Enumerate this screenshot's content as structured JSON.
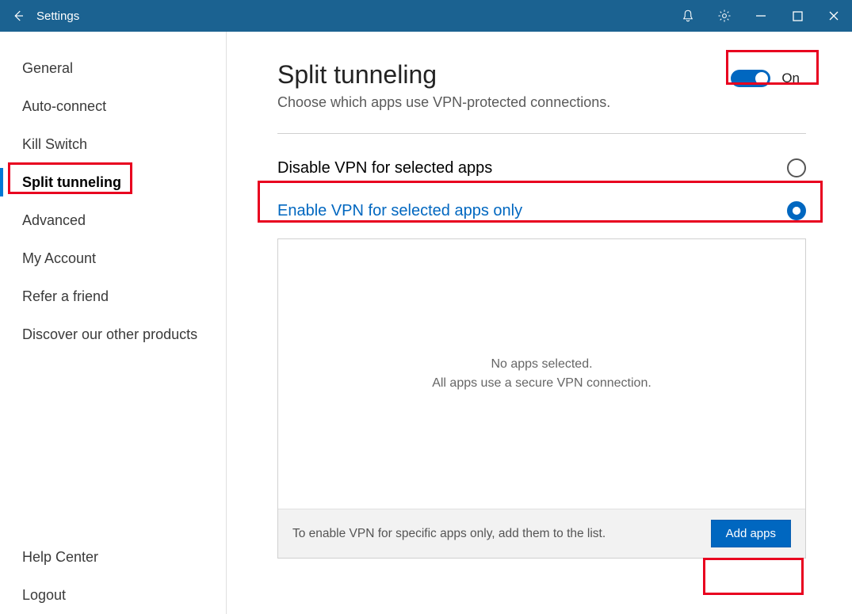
{
  "titlebar": {
    "title": "Settings"
  },
  "sidebar": {
    "items": [
      {
        "label": "General"
      },
      {
        "label": "Auto-connect"
      },
      {
        "label": "Kill Switch"
      },
      {
        "label": "Split tunneling"
      },
      {
        "label": "Advanced"
      },
      {
        "label": "My Account"
      },
      {
        "label": "Refer a friend"
      },
      {
        "label": "Discover our other products"
      }
    ],
    "bottom": [
      {
        "label": "Help Center"
      },
      {
        "label": "Logout"
      }
    ]
  },
  "content": {
    "heading": "Split tunneling",
    "subtitle": "Choose which apps use VPN-protected connections.",
    "toggle_label": "On",
    "option_disable": "Disable VPN for selected apps",
    "option_enable": "Enable VPN for selected apps only",
    "empty_line1": "No apps selected.",
    "empty_line2": "All apps use a secure VPN connection.",
    "footer_hint": "To enable VPN for specific apps only, add them to the list.",
    "add_apps": "Add apps"
  }
}
